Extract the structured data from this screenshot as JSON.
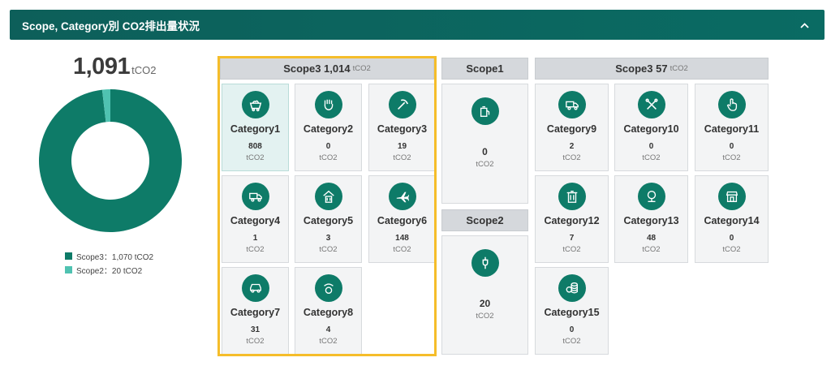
{
  "header": {
    "title": "Scope, Category別 CO2排出量状況",
    "collapse_icon": "chevron-up-icon"
  },
  "total": {
    "value": "1,091",
    "unit": "tCO2"
  },
  "chart_data": {
    "type": "pie",
    "donut": true,
    "categories": [
      "Scope3",
      "Scope2"
    ],
    "values": [
      1070,
      20
    ],
    "colors": [
      "#0e7b68",
      "#4fc2b1"
    ],
    "legend": [
      "Scope3：1,070 tCO2",
      "Scope2：20 tCO2"
    ],
    "legend_position": "bottom"
  },
  "groups": {
    "scope3_upstream": {
      "title": "Scope3 1,014",
      "unit": "tCO2"
    },
    "scope1": {
      "title": "Scope1"
    },
    "scope2": {
      "title": "Scope2"
    },
    "scope3_downstream": {
      "title": "Scope3 57",
      "unit": "tCO2"
    }
  },
  "categories": [
    {
      "name": "Category1",
      "value": "808",
      "unit": "tCO2",
      "icon": "cart-icon"
    },
    {
      "name": "Category2",
      "value": "0",
      "unit": "tCO2",
      "icon": "hand-icon"
    },
    {
      "name": "Category3",
      "value": "19",
      "unit": "tCO2",
      "icon": "pickaxe-icon"
    },
    {
      "name": "Category4",
      "value": "1",
      "unit": "tCO2",
      "icon": "truck-icon"
    },
    {
      "name": "Category5",
      "value": "3",
      "unit": "tCO2",
      "icon": "recycle-bin-icon"
    },
    {
      "name": "Category6",
      "value": "148",
      "unit": "tCO2",
      "icon": "airplane-icon"
    },
    {
      "name": "Category7",
      "value": "31",
      "unit": "tCO2",
      "icon": "car-icon"
    },
    {
      "name": "Category8",
      "value": "4",
      "unit": "tCO2",
      "icon": "cloud-fuel-icon"
    },
    {
      "name": "Category9",
      "value": "2",
      "unit": "tCO2",
      "icon": "truck-icon"
    },
    {
      "name": "Category10",
      "value": "0",
      "unit": "tCO2",
      "icon": "tools-icon"
    },
    {
      "name": "Category11",
      "value": "0",
      "unit": "tCO2",
      "icon": "hand-pointer-icon"
    },
    {
      "name": "Category12",
      "value": "7",
      "unit": "tCO2",
      "icon": "recycle-bin-icon"
    },
    {
      "name": "Category13",
      "value": "48",
      "unit": "tCO2",
      "icon": "building-icon"
    },
    {
      "name": "Category14",
      "value": "0",
      "unit": "tCO2",
      "icon": "shop-icon"
    },
    {
      "name": "Category15",
      "value": "0",
      "unit": "tCO2",
      "icon": "coins-icon"
    }
  ],
  "scopes": [
    {
      "key": "scope1",
      "value": "0",
      "unit": "tCO2",
      "icon": "fuel-pump-icon"
    },
    {
      "key": "scope2",
      "value": "20",
      "unit": "tCO2",
      "icon": "plug-icon"
    }
  ],
  "highlight_color": "#f5bd2a"
}
